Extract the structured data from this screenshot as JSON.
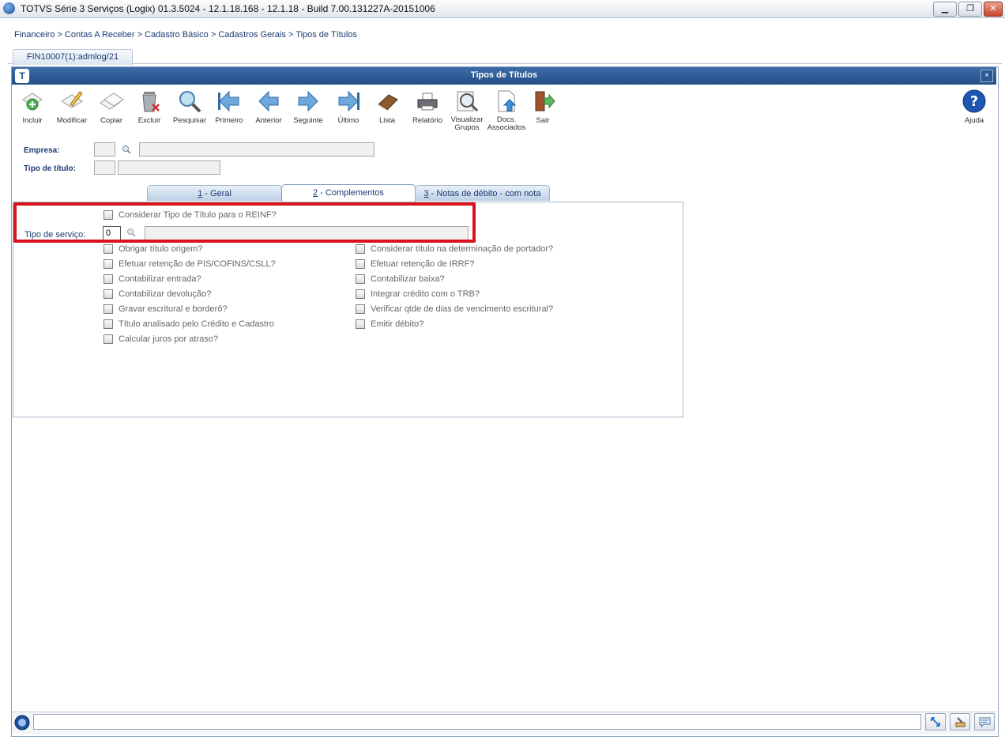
{
  "window": {
    "title": "TOTVS Série 3 Serviços (Logix) 01.3.5024  -  12.1.18.168 - 12.1.18 - Build 7.00.131227A-20151006",
    "minimize_label": "▁",
    "restore_label": "❐",
    "close_label": "✕"
  },
  "breadcrumb": "Financeiro > Contas A Receber > Cadastro Básico > Cadastros Gerais > Tipos de Títulos",
  "program_tab": "FIN10007(1):admlog/21",
  "form_window": {
    "title": "Tipos de Títulos",
    "logo": "T",
    "close_label": "×"
  },
  "toolbar": {
    "incluir": "Incluir",
    "modificar": "Modificar",
    "copiar": "Copiar",
    "excluir": "Excluir",
    "pesquisar": "Pesquisar",
    "primeiro": "Primeiro",
    "anterior": "Anterior",
    "seguinte": "Seguinte",
    "ultimo": "Último",
    "lista": "Lista",
    "relatorio": "Relatório",
    "visualizar_grupos_1": "Visualizar",
    "visualizar_grupos_2": "Grupos",
    "docs_associados_1": "Docs.",
    "docs_associados_2": "Associados",
    "sair": "Sair",
    "ajuda": "Ajuda"
  },
  "form": {
    "empresa_label": "Empresa:",
    "empresa_code": "",
    "empresa_name": "",
    "tipo_titulo_label": "Tipo de título:",
    "tipo_titulo_code": "",
    "tipo_titulo_name": ""
  },
  "tabs": [
    {
      "num": "1",
      "label": " - Geral"
    },
    {
      "num": "2",
      "label": " - Complementos"
    },
    {
      "num": "3",
      "label": " - Notas de débito - com nota"
    }
  ],
  "complementos": {
    "reinf_label": "Considerar Tipo de Título para o REINF?",
    "tipo_servico_label": "Tipo de serviço:",
    "tipo_servico_value": "0",
    "tipo_servico_desc": "",
    "left_checks": [
      "Obrigar título origem?",
      "Efetuar retenção de PIS/COFINS/CSLL?",
      "Contabilizar entrada?",
      "Contabilizar devolução?",
      "Gravar escritural e borderô?",
      "Título analisado pelo Crédito e Cadastro",
      "Calcular juros por atraso?"
    ],
    "right_checks": [
      "Considerar título na determinação de portador?",
      "Efetuar retenção de IRRF?",
      "Contabilizar baixa?",
      "Integrar crédito com o TRB?",
      "Verificar qtde de dias de vencimento escritural?",
      "Emitir débito?"
    ]
  },
  "status": {
    "message": ""
  },
  "colors": {
    "title_bar_blue": "#2f5e99",
    "highlight_red": "#d8131b",
    "label_blue": "#1b3a73"
  }
}
